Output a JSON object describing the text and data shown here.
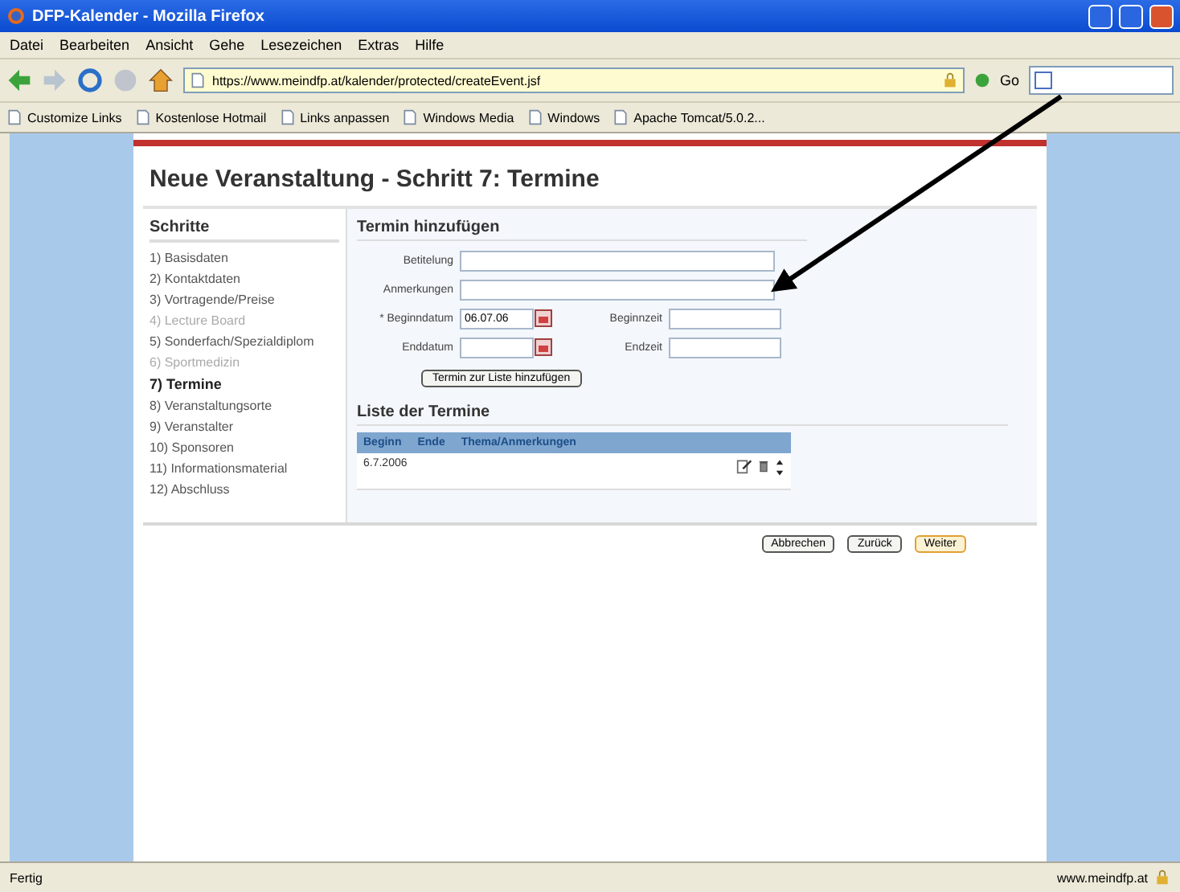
{
  "window": {
    "title": "DFP-Kalender - Mozilla Firefox"
  },
  "menu": [
    "Datei",
    "Bearbeiten",
    "Ansicht",
    "Gehe",
    "Lesezeichen",
    "Extras",
    "Hilfe"
  ],
  "toolbar": {
    "url": "https://www.meindfp.at/kalender/protected/createEvent.jsf",
    "go": "Go"
  },
  "bookmarks": [
    "Customize Links",
    "Kostenlose Hotmail",
    "Links anpassen",
    "Windows Media",
    "Windows",
    "Apache Tomcat/5.0.2..."
  ],
  "page": {
    "title": "Neue Veranstaltung - Schritt 7: Termine",
    "steps_title": "Schritte",
    "steps": [
      {
        "label": "1) Basisdaten",
        "selected": false,
        "disabled": false
      },
      {
        "label": "2) Kontaktdaten",
        "selected": false,
        "disabled": false
      },
      {
        "label": "3) Vortragende/Preise",
        "selected": false,
        "disabled": false
      },
      {
        "label": "4) Lecture Board",
        "selected": false,
        "disabled": true
      },
      {
        "label": "5) Sonderfach/Spezialdiplom",
        "selected": false,
        "disabled": false
      },
      {
        "label": "6) Sportmedizin",
        "selected": false,
        "disabled": true
      },
      {
        "label": "7) Termine",
        "selected": true,
        "disabled": false
      },
      {
        "label": "8) Veranstaltungsorte",
        "selected": false,
        "disabled": false
      },
      {
        "label": "9) Veranstalter",
        "selected": false,
        "disabled": false
      },
      {
        "label": "10) Sponsoren",
        "selected": false,
        "disabled": false
      },
      {
        "label": "11) Informationsmaterial",
        "selected": false,
        "disabled": false
      },
      {
        "label": "12) Abschluss",
        "selected": false,
        "disabled": false
      }
    ],
    "form_title": "Termin hinzufügen",
    "form_rows": [
      [
        {
          "label": "Betitelung",
          "kind": "text"
        }
      ],
      [
        {
          "label": "Anmerkungen",
          "kind": "text"
        }
      ],
      [
        {
          "label": "* Beginndatum",
          "kind": "date",
          "value": "06.07.06"
        },
        {
          "label": "Beginnzeit",
          "kind": "time"
        }
      ],
      [
        {
          "label": "Enddatum",
          "kind": "date"
        },
        {
          "label": "Endzeit",
          "kind": "time"
        }
      ]
    ],
    "add_button": "Termin zur Liste hinzufügen",
    "list_title": "Liste der Termine",
    "columns": [
      "Beginn",
      "Ende",
      "Thema/Anmerkungen"
    ],
    "rows": [
      {
        "begin": "6.7.2006"
      }
    ],
    "buttons": [
      {
        "label": "Abbrechen",
        "kind": "normal"
      },
      {
        "label": "Zurück",
        "kind": "normal"
      },
      {
        "label": "Weiter",
        "kind": "primary"
      }
    ]
  },
  "status": {
    "text": "Fertig",
    "domain": "www.meindfp.at"
  }
}
